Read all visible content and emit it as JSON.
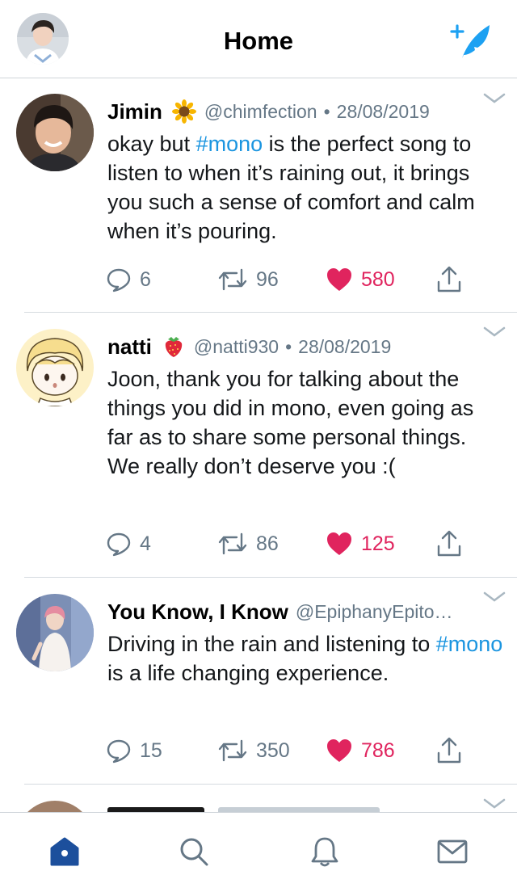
{
  "header": {
    "title": "Home"
  },
  "tweets": [
    {
      "name": "Jimin",
      "emoji": "sunflower-emoji",
      "handle": "@chimfection",
      "date": "28/08/2019",
      "body": [
        "okay but ",
        "#mono",
        " is the perfect song to listen to when it’s raining out, it brings you such a sense of comfort and calm when it’s pouring."
      ],
      "replies": "6",
      "retweets": "96",
      "likes": "580"
    },
    {
      "name": "natti",
      "emoji": "strawberry-emoji",
      "handle": "@natti930",
      "date": "28/08/2019",
      "body": [
        "Joon, thank you for talking about the things you did in mono, even going as far as to share some personal things. We really don’t deserve you :("
      ],
      "replies": "4",
      "retweets": "86",
      "likes": "125"
    },
    {
      "name": "You Know, I Know",
      "handle": "@EpiphanyEpito…",
      "body": [
        "Driving in the rain and listening to ",
        "#mono",
        " is a life changing experience."
      ],
      "replies": "15",
      "retweets": "350",
      "likes": "786"
    }
  ],
  "separator": "•",
  "colors": {
    "accent": "#1da1f2",
    "hashtag": "#1b95e0",
    "like": "#e0245e",
    "muted": "#657786",
    "home_active": "#1c4f9c"
  },
  "tabs": [
    {
      "icon": "home-icon",
      "active": true
    },
    {
      "icon": "search-icon"
    },
    {
      "icon": "bell-icon"
    },
    {
      "icon": "mail-icon"
    }
  ]
}
